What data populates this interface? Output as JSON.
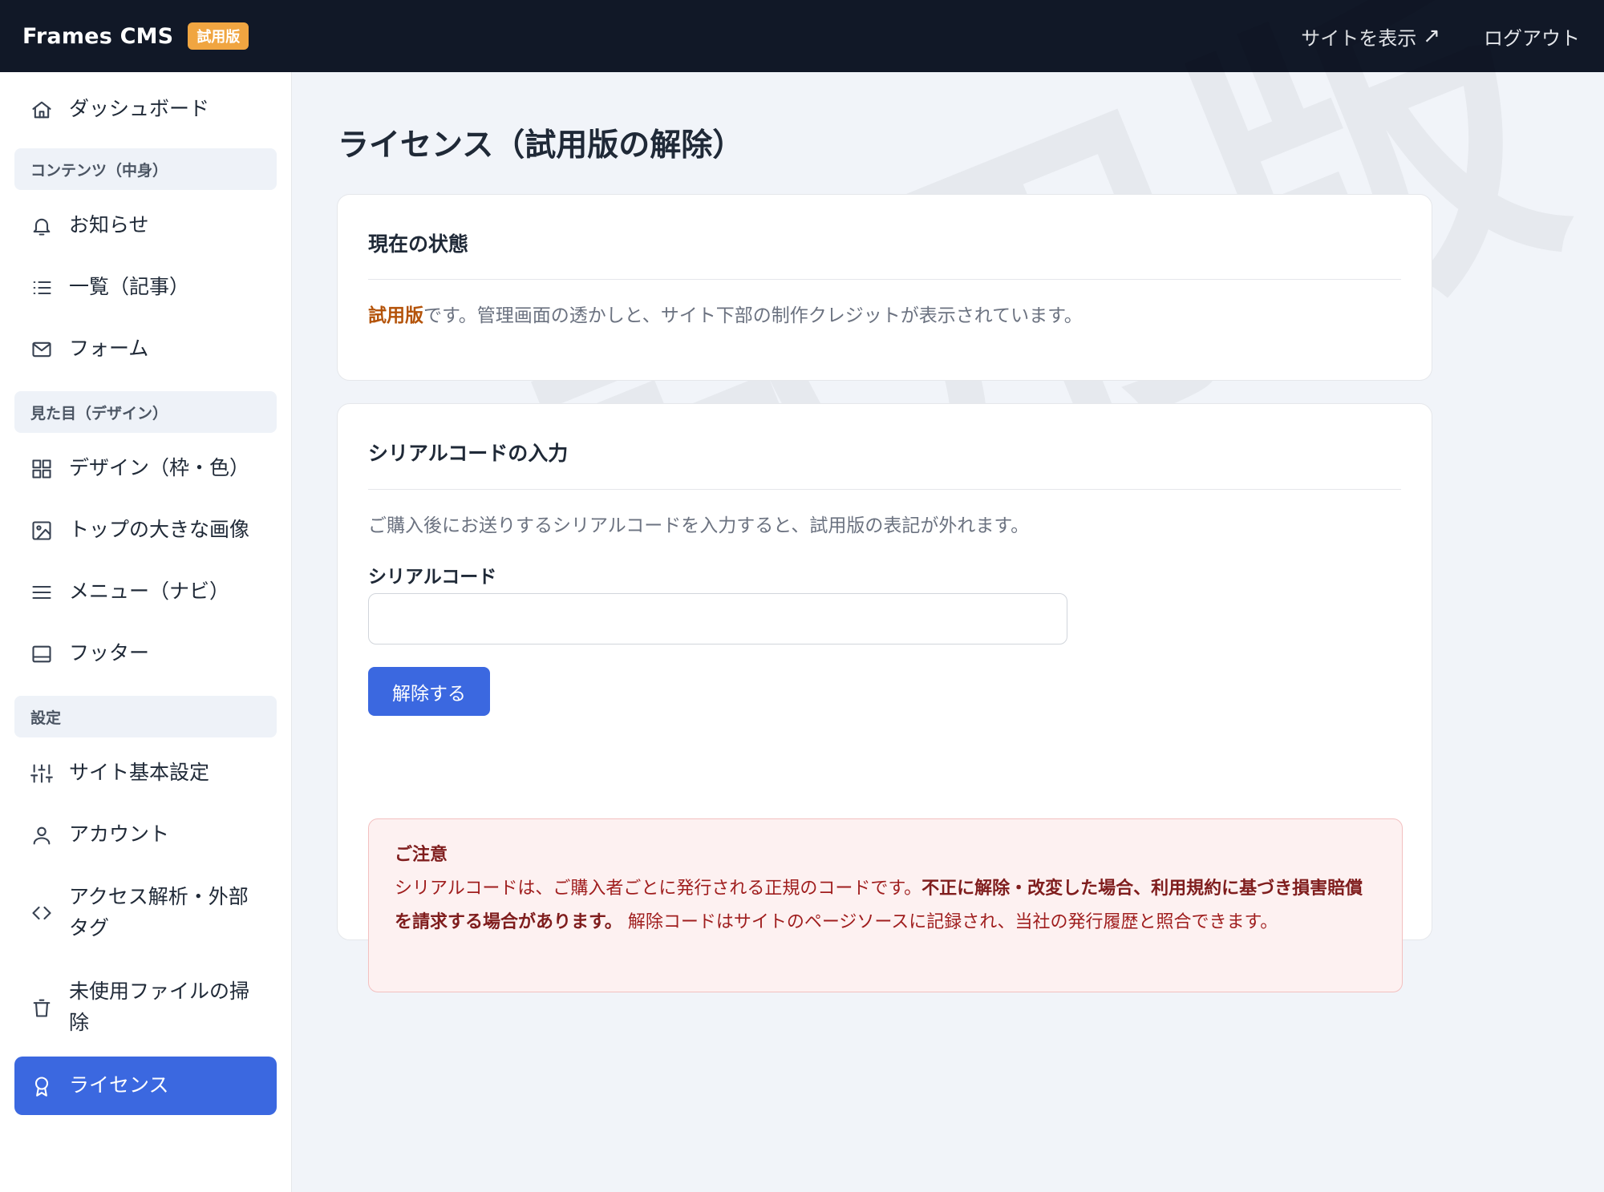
{
  "header": {
    "brand": "Frames CMS",
    "badge": "試用版",
    "view_site": "サイトを表示",
    "view_site_arrow": "↗",
    "logout": "ログアウト"
  },
  "sidebar": {
    "dashboard": {
      "label": "ダッシュボード",
      "icon": "home-icon"
    },
    "sections": [
      {
        "label": "コンテンツ（中身）",
        "items": [
          {
            "label": "お知らせ",
            "icon": "bell-icon"
          },
          {
            "label": "一覧（記事）",
            "icon": "list-icon"
          },
          {
            "label": "フォーム",
            "icon": "mail-icon"
          }
        ]
      },
      {
        "label": "見た目（デザイン）",
        "items": [
          {
            "label": "デザイン（枠・色）",
            "icon": "grid-icon"
          },
          {
            "label": "トップの大きな画像",
            "icon": "image-icon"
          },
          {
            "label": "メニュー（ナビ）",
            "icon": "menu-icon"
          },
          {
            "label": "フッター",
            "icon": "footer-icon"
          }
        ]
      },
      {
        "label": "設定",
        "items": [
          {
            "label": "サイト基本設定",
            "icon": "sliders-icon"
          },
          {
            "label": "アカウント",
            "icon": "user-icon"
          },
          {
            "label": "アクセス解析・外部タグ",
            "icon": "code-icon"
          },
          {
            "label": "未使用ファイルの掃除",
            "icon": "trash-icon"
          },
          {
            "label": "ライセンス",
            "icon": "award-icon",
            "active": true
          }
        ]
      }
    ]
  },
  "main": {
    "title": "ライセンス（試用版の解除）",
    "status_card": {
      "title": "現在の状態",
      "status_highlight": "試用版",
      "status_text": "です。管理画面の透かしと、サイト下部の制作クレジットが表示されています。"
    },
    "serial_card": {
      "title": "シリアルコードの入力",
      "description": "ご購入後にお送りするシリアルコードを入力すると、試用版の表記が外れます。",
      "field_label": "シリアルコード",
      "input_value": "",
      "button_label": "解除する",
      "notice": {
        "title": "ご注意",
        "text1": "シリアルコードは、ご購入者ごとに発行される正規のコードです。",
        "text_bold": "不正に解除・改変した場合、利用規約に基づき損害賠償を請求する場合があります。",
        "text2": "解除コードはサイトのページソースに記録され、当社の発行履歴と照合できます。"
      }
    },
    "watermark": "試用版"
  },
  "colors": {
    "topbar": "#111827",
    "accent": "#3b68e0",
    "badge": "#f0a541",
    "status_highlight": "#b45309",
    "notice_bg": "#fdf1f1"
  }
}
